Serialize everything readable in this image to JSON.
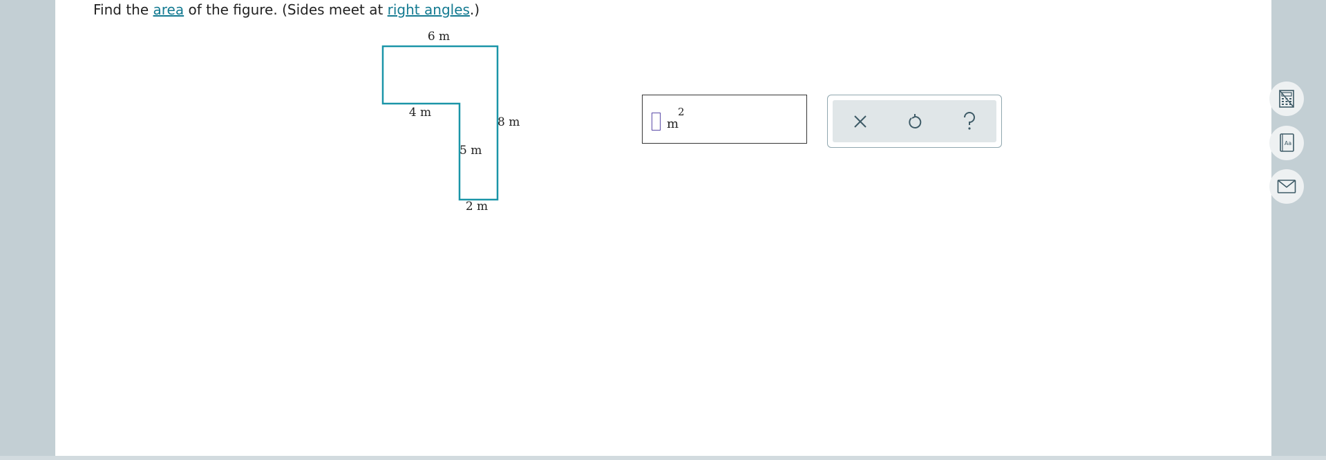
{
  "question": {
    "prefix": "Find the ",
    "link1": "area",
    "middle": " of the figure. (Sides meet at ",
    "link2": "right angles",
    "suffix": ".)"
  },
  "figure": {
    "labels": {
      "top": "6 m",
      "left_inner": "4 m",
      "right": "8 m",
      "inner_vertical": "5 m",
      "bottom": "2 m"
    },
    "stroke_color": "#1a95a8"
  },
  "answer": {
    "value": "",
    "unit": "m",
    "exponent": "2"
  },
  "toolbox": {
    "buttons": [
      {
        "icon": "close-icon",
        "glyph": "×"
      },
      {
        "icon": "undo-icon",
        "glyph": "↺"
      },
      {
        "icon": "help-icon",
        "glyph": "?"
      }
    ]
  },
  "sidebar": {
    "buttons": [
      {
        "icon": "calculator-icon"
      },
      {
        "icon": "glossary-book-icon",
        "text": "Aa"
      },
      {
        "icon": "mail-icon"
      }
    ]
  },
  "colors": {
    "link": "#137a91",
    "accent": "#1a95a8",
    "background": "#c3cfd4"
  }
}
